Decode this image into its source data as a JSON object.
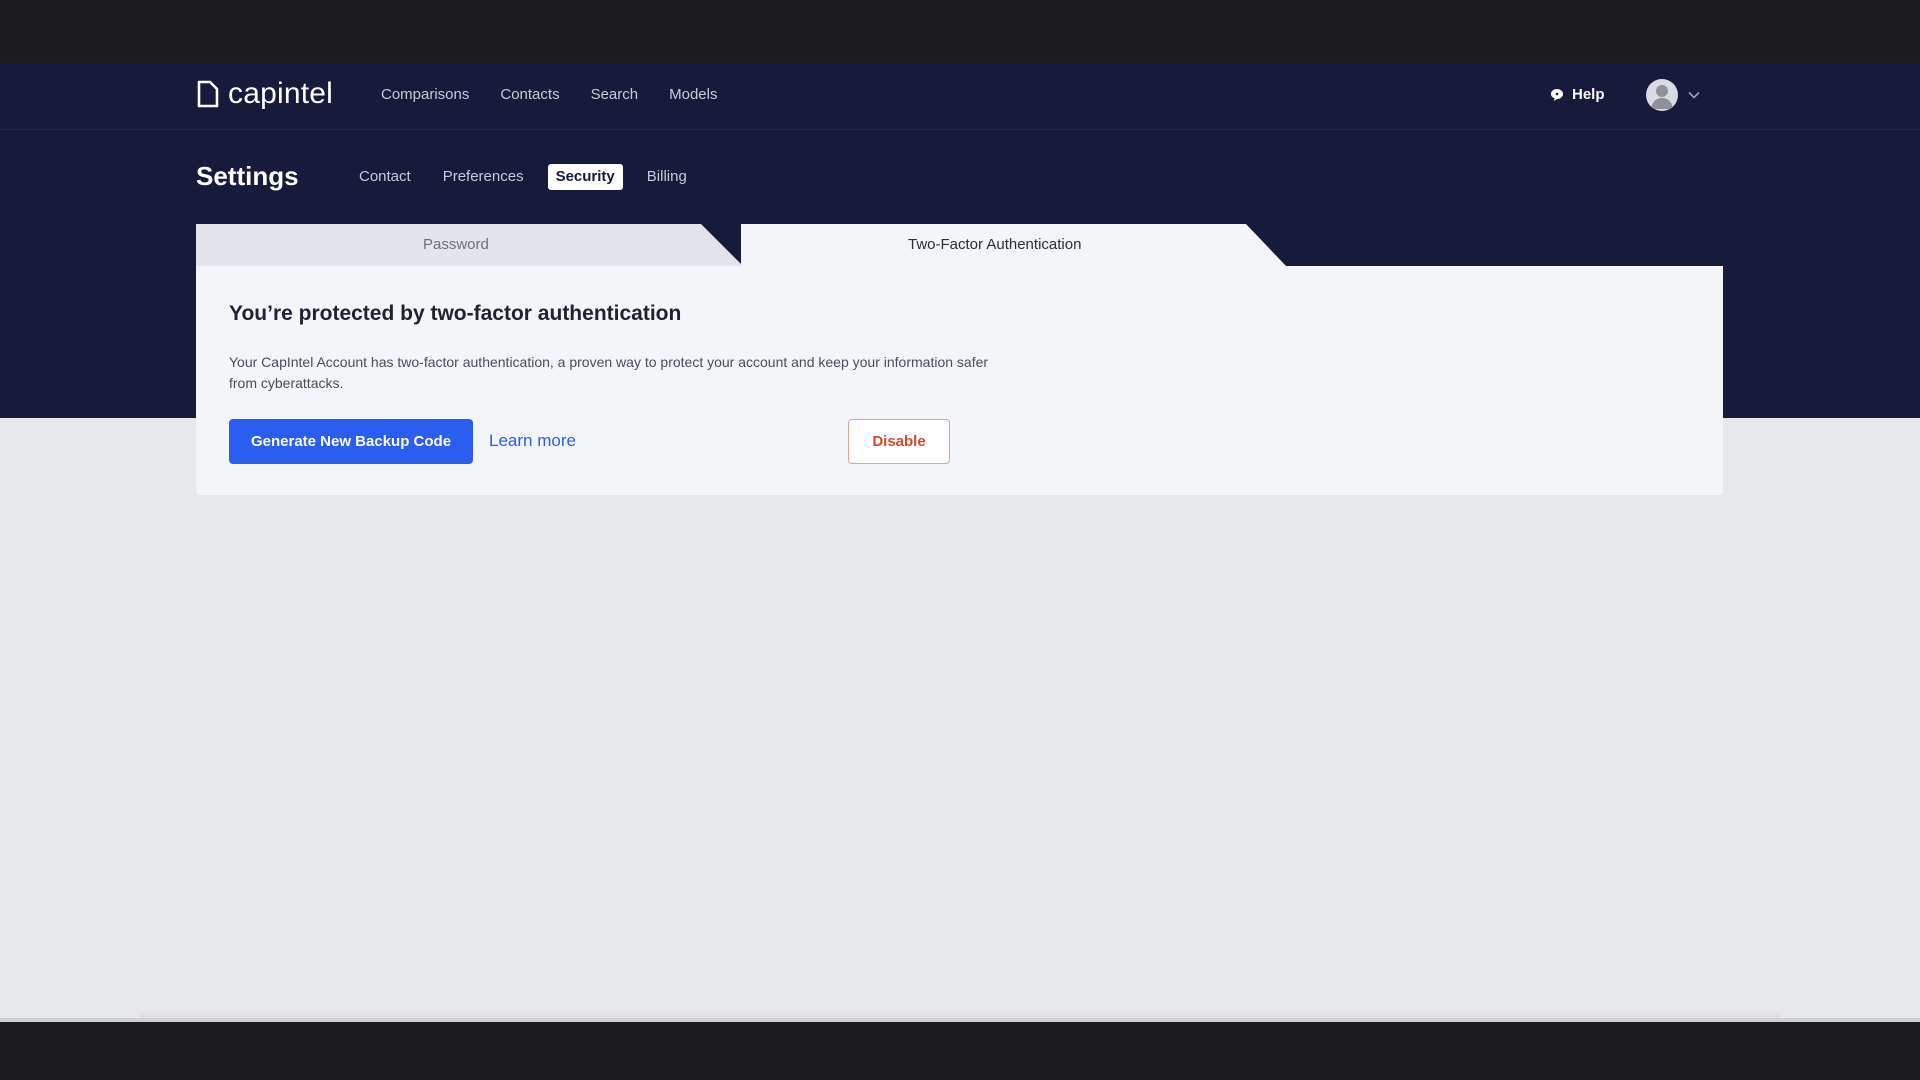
{
  "topnav": {
    "logo_text": "capintel",
    "links": [
      "Comparisons",
      "Contacts",
      "Search",
      "Models"
    ],
    "help_label": "Help"
  },
  "settings": {
    "title": "Settings",
    "subtabs": [
      "Contact",
      "Preferences",
      "Security",
      "Billing"
    ],
    "active_subtab": "Security"
  },
  "security": {
    "tabs": [
      "Password",
      "Two-Factor Authentication"
    ],
    "active_tab": "Two-Factor Authentication",
    "card": {
      "title": "You’re protected by two-factor authentication",
      "description": "Your CapIntel Account has two-factor authentication, a proven way to protect your account and keep your information safer from cyberattacks.",
      "primary_button": "Generate New Backup Code",
      "learn_more": "Learn more",
      "disable_button": "Disable"
    }
  },
  "colors": {
    "nav_bg": "#161b3b",
    "primary": "#2a5ef0",
    "danger": "#d6482e",
    "page_bg": "#e7e8ec"
  },
  "icons": [
    "logo-icon",
    "help-chat-icon",
    "avatar-icon",
    "chevron-down-icon"
  ]
}
